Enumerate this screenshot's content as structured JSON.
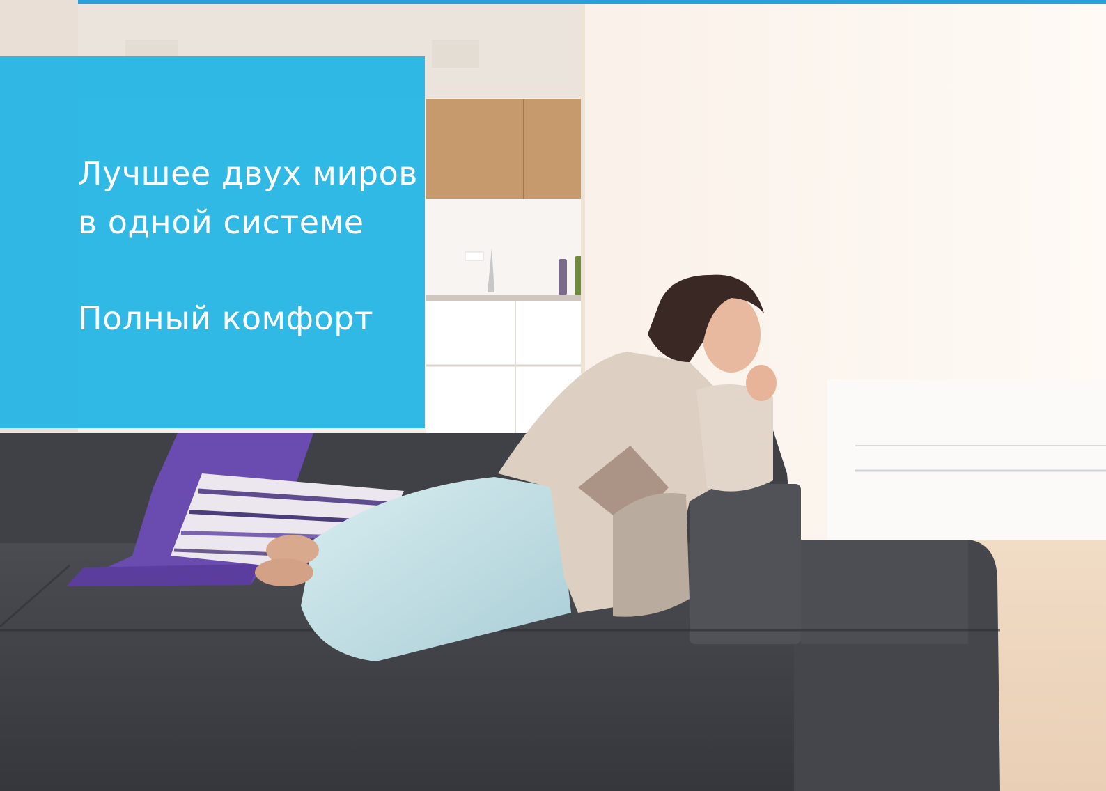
{
  "brochure": {
    "headline_line1": "Лучшее двух миров",
    "headline_line2": "в одной системе",
    "subheadline": "Полный комфорт"
  },
  "colors": {
    "panel": "#1cb2e4",
    "rule": "#2a9fdc",
    "text": "#ffffff"
  }
}
